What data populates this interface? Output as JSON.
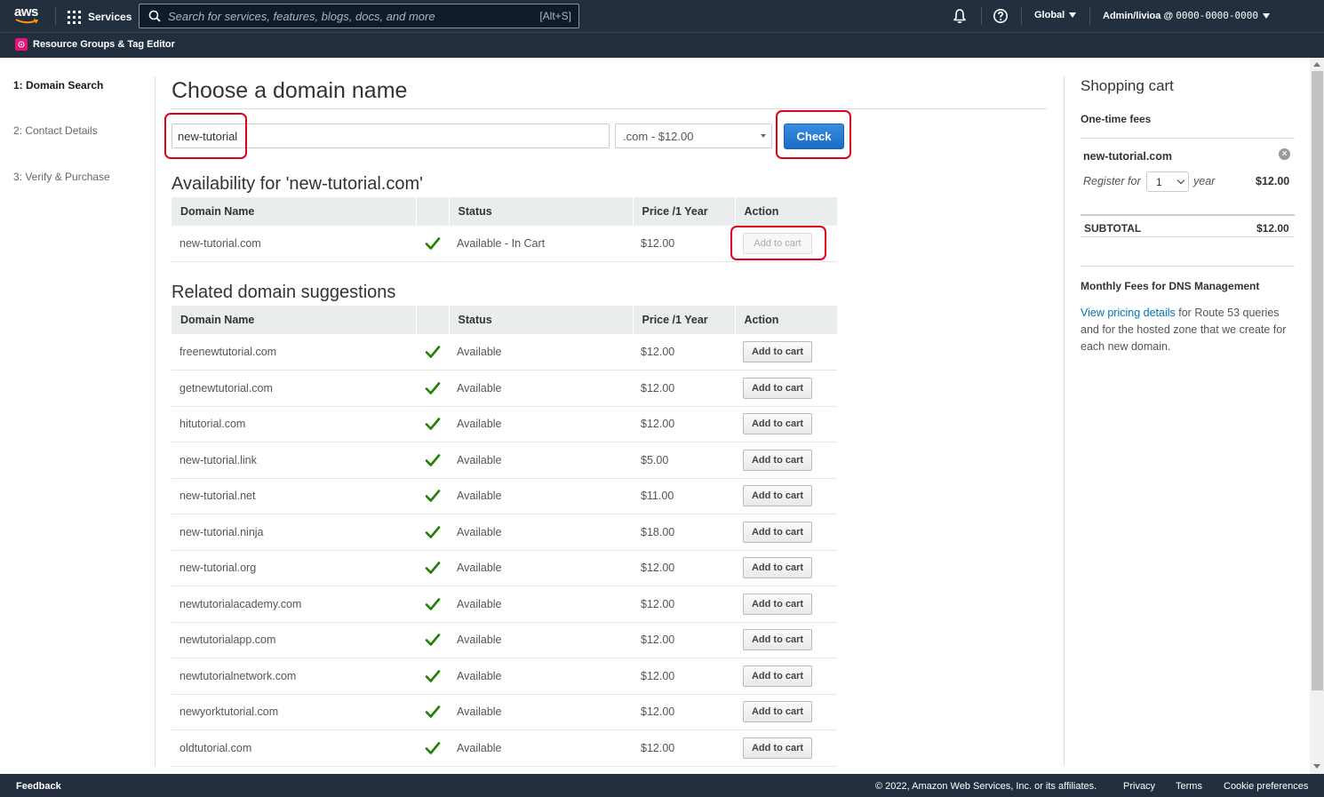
{
  "topnav": {
    "logo_text": "aws",
    "services_label": "Services",
    "search_placeholder": "Search for services, features, blogs, docs, and more",
    "search_shortcut": "[Alt+S]",
    "region_label": "Global",
    "account_user": "Admin/livioa @",
    "account_id": "0000-0000-0000",
    "resource_groups_label": "Resource Groups & Tag Editor"
  },
  "steps": [
    {
      "label": "1: Domain Search",
      "active": true
    },
    {
      "label": "2: Contact Details",
      "active": false
    },
    {
      "label": "3: Verify & Purchase",
      "active": false
    }
  ],
  "main": {
    "title": "Choose a domain name",
    "domain_input_value": "new-tutorial",
    "tld_selected": ".com - $12.00",
    "check_label": "Check",
    "availability_title": "Availability for 'new-tutorial.com'",
    "related_title": "Related domain suggestions",
    "columns": [
      "Domain Name",
      "",
      "Status",
      "Price /1 Year",
      "Action"
    ],
    "availability_rows": [
      {
        "domain": "new-tutorial.com",
        "status": "Available - In Cart",
        "price": "$12.00",
        "action": "Add to cart"
      }
    ],
    "related_rows": [
      {
        "domain": "freenewtutorial.com",
        "status": "Available",
        "price": "$12.00",
        "action": "Add to cart"
      },
      {
        "domain": "getnewtutorial.com",
        "status": "Available",
        "price": "$12.00",
        "action": "Add to cart"
      },
      {
        "domain": "hitutorial.com",
        "status": "Available",
        "price": "$12.00",
        "action": "Add to cart"
      },
      {
        "domain": "new-tutorial.link",
        "status": "Available",
        "price": "$5.00",
        "action": "Add to cart"
      },
      {
        "domain": "new-tutorial.net",
        "status": "Available",
        "price": "$11.00",
        "action": "Add to cart"
      },
      {
        "domain": "new-tutorial.ninja",
        "status": "Available",
        "price": "$18.00",
        "action": "Add to cart"
      },
      {
        "domain": "new-tutorial.org",
        "status": "Available",
        "price": "$12.00",
        "action": "Add to cart"
      },
      {
        "domain": "newtutorialacademy.com",
        "status": "Available",
        "price": "$12.00",
        "action": "Add to cart"
      },
      {
        "domain": "newtutorialapp.com",
        "status": "Available",
        "price": "$12.00",
        "action": "Add to cart"
      },
      {
        "domain": "newtutorialnetwork.com",
        "status": "Available",
        "price": "$12.00",
        "action": "Add to cart"
      },
      {
        "domain": "newyorktutorial.com",
        "status": "Available",
        "price": "$12.00",
        "action": "Add to cart"
      },
      {
        "domain": "oldtutorial.com",
        "status": "Available",
        "price": "$12.00",
        "action": "Add to cart"
      }
    ]
  },
  "cart": {
    "title": "Shopping cart",
    "one_time_fees": "One-time fees",
    "item_domain": "new-tutorial.com",
    "register_for": "Register for",
    "years_value": "1",
    "year_label": "year",
    "item_price": "$12.00",
    "subtotal_label": "SUBTOTAL",
    "subtotal_value": "$12.00",
    "monthly_fees_title": "Monthly Fees for DNS Management",
    "pricing_link": "View pricing details",
    "pricing_text": " for Route 53 queries and for the hosted zone that we create for each new domain."
  },
  "footer": {
    "feedback": "Feedback",
    "copyright": "© 2022, Amazon Web Services, Inc. or its affiliates.",
    "privacy": "Privacy",
    "terms": "Terms",
    "cookies": "Cookie preferences"
  },
  "colors": {
    "nav_bg": "#232f3e",
    "primary_button": "#1a6cc8",
    "link": "#0073bb",
    "available_check": "#1d8102",
    "highlight": "#e0001b"
  },
  "icons": [
    "grid-icon",
    "search-icon",
    "bell-icon",
    "help-icon",
    "resource-groups-icon",
    "check-icon",
    "remove-icon"
  ]
}
